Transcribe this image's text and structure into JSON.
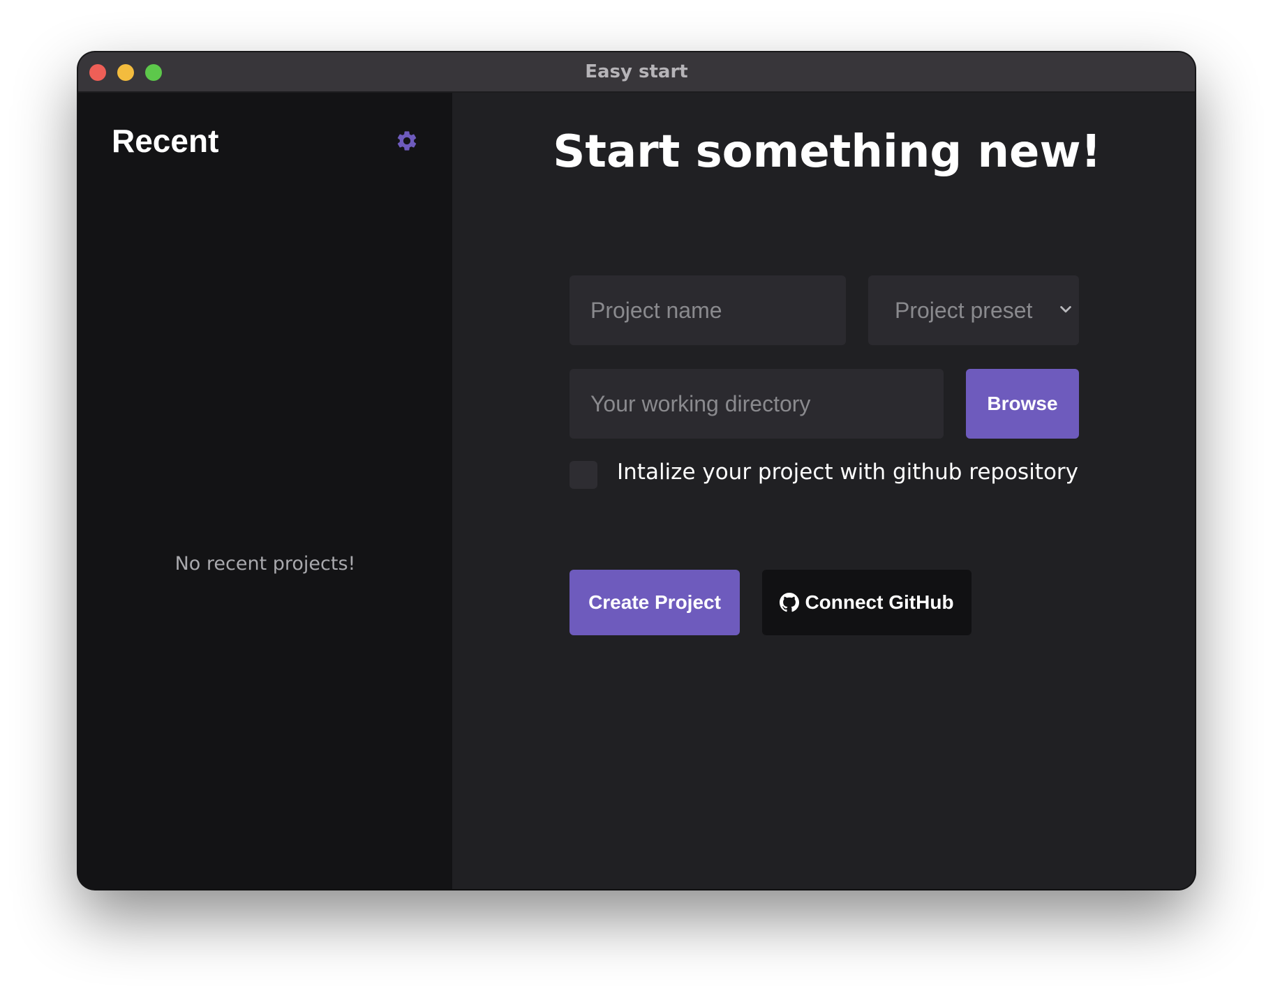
{
  "window": {
    "title": "Easy start",
    "controls": [
      "close",
      "minimize",
      "maximize"
    ]
  },
  "sidebar": {
    "title": "Recent",
    "settings_icon": "gear-icon",
    "empty_message": "No recent projects!"
  },
  "main": {
    "headline": "Start something new!",
    "project_name": {
      "value": "",
      "placeholder": "Project name"
    },
    "project_preset": {
      "selected": "Project preset",
      "icon": "chevron-down-icon"
    },
    "working_directory": {
      "value": "",
      "placeholder": "Your working directory"
    },
    "browse_label": "Browse",
    "github_checkbox": {
      "checked": false,
      "label": "Intalize your project with github repository"
    },
    "create_label": "Create Project",
    "connect_github_label": "Connect GitHub",
    "connect_github_icon": "github-icon"
  },
  "colors": {
    "accent": "#6e5bbd",
    "sidebar_bg": "#131315",
    "main_bg": "#202023",
    "field_bg": "#2b2a2f",
    "titlebar_bg": "#38363a"
  }
}
